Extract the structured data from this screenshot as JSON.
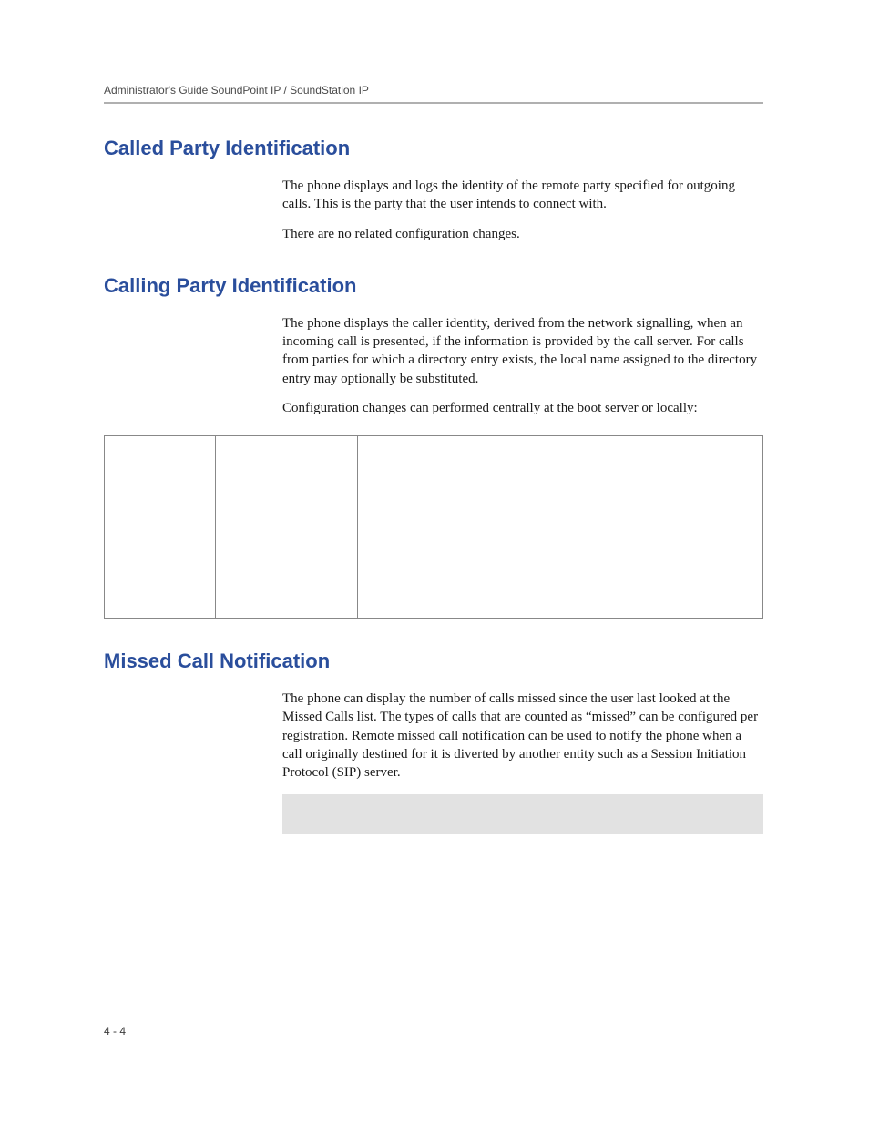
{
  "header": {
    "running_title": "Administrator's Guide SoundPoint IP / SoundStation IP"
  },
  "sections": [
    {
      "heading": "Called Party Identification",
      "paragraphs": [
        "The phone displays and logs the identity of the remote party specified for outgoing calls. This is the party that the user intends to connect with.",
        "There are no related configuration changes."
      ]
    },
    {
      "heading": "Calling Party Identification",
      "paragraphs": [
        "The phone displays the caller identity, derived from the network signalling, when an incoming call is presented, if the information is provided by the call server. For calls from parties for which a directory entry exists, the local name assigned to the directory entry may optionally be substituted.",
        "Configuration changes can performed centrally at the boot server or locally:"
      ],
      "has_table": true
    },
    {
      "heading": "Missed Call Notification",
      "paragraphs": [
        "The phone can display the number of calls missed since the user last looked at the Missed Calls list. The types of calls that are counted as “missed” can be configured per registration. Remote missed call notification can be used to notify the phone when a call originally destined for it is diverted by another entity such as a Session Initiation Protocol (SIP) server."
      ],
      "has_note": true
    }
  ],
  "footer": {
    "page_number": "4 - 4"
  }
}
